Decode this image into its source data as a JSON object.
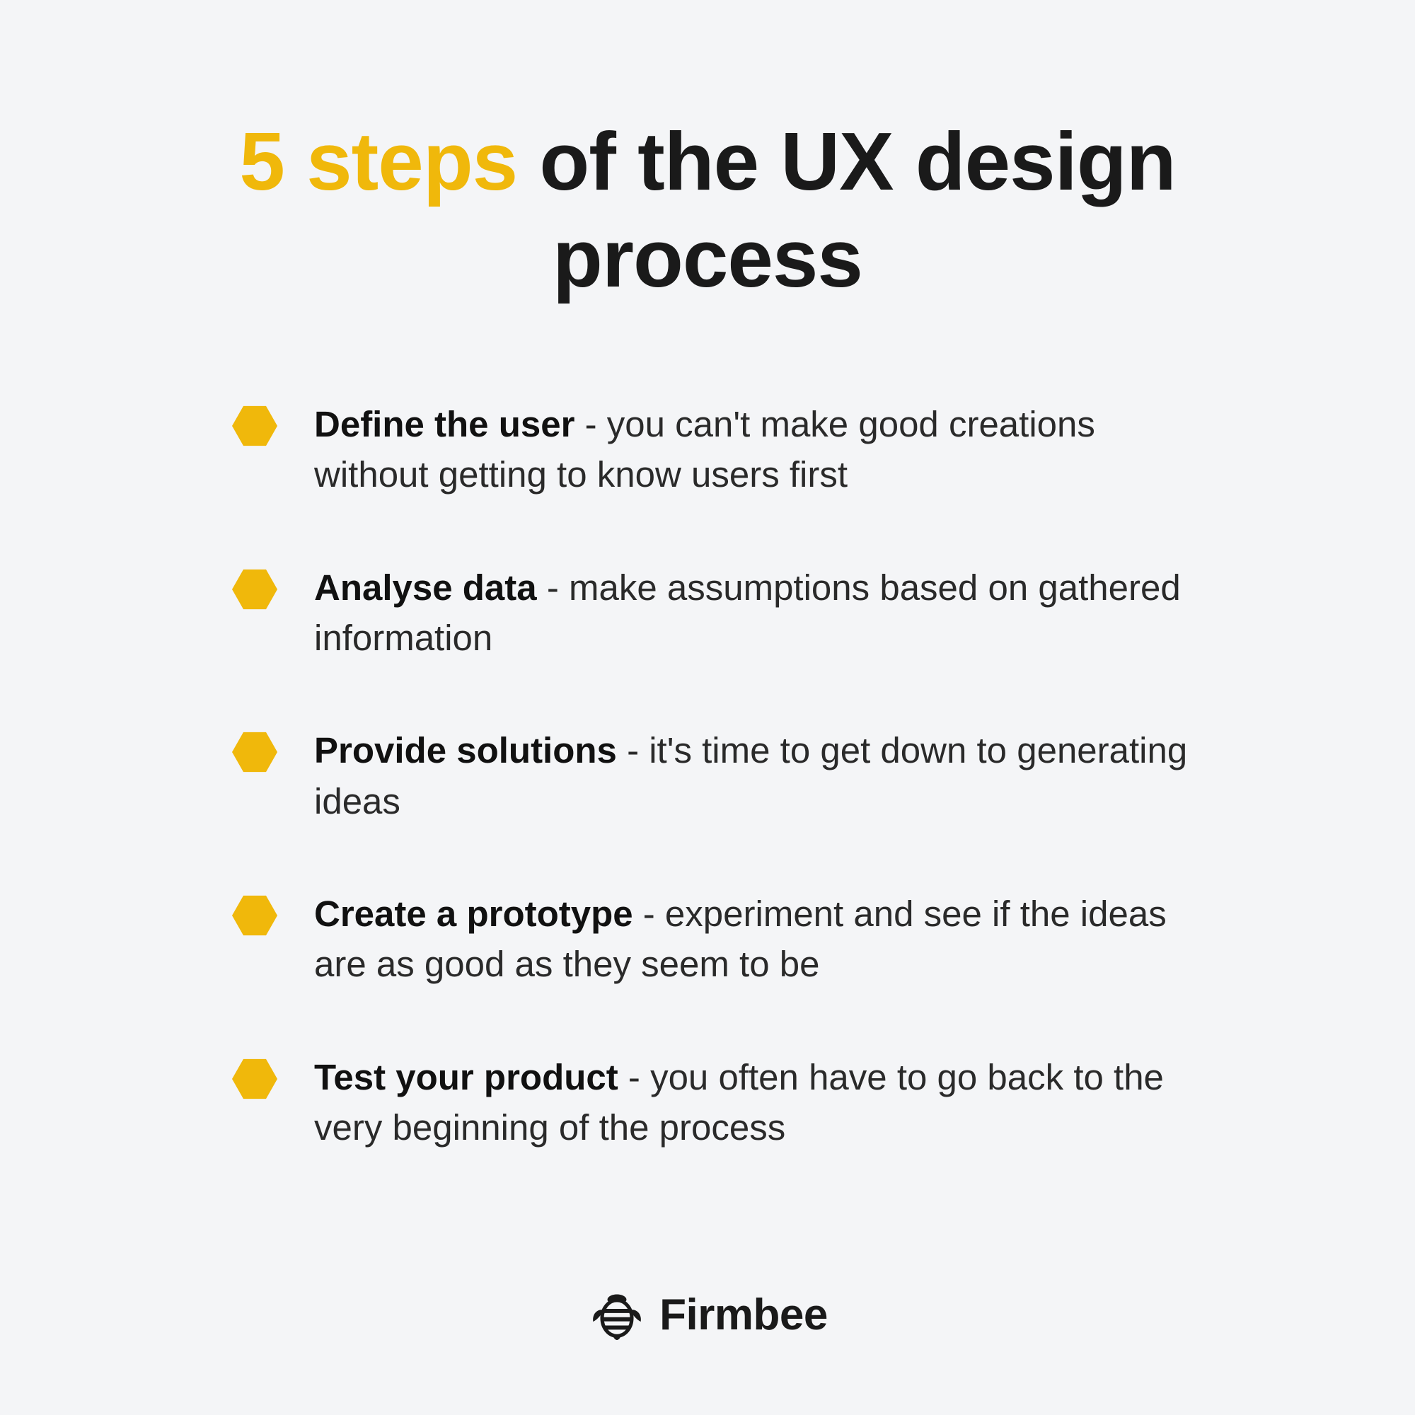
{
  "title": {
    "accent": "5 steps",
    "rest": " of the UX design process"
  },
  "steps": [
    {
      "bold": "Define the user",
      "rest": " - you can't make good creations without getting to know users first"
    },
    {
      "bold": "Analyse data",
      "rest": " - make assumptions based on gathered information"
    },
    {
      "bold": "Provide solutions",
      "rest": " - it's time to get down to generating ideas"
    },
    {
      "bold": "Create a prototype",
      "rest": " - experiment and see if the ideas are as good as they seem to be"
    },
    {
      "bold": "Test your product",
      "rest": " - you often have to go back to the very beginning of the process"
    }
  ],
  "brand": "Firmbee",
  "colors": {
    "accent": "#f0b80b",
    "text": "#1a1a1a",
    "background": "#f4f5f7"
  }
}
